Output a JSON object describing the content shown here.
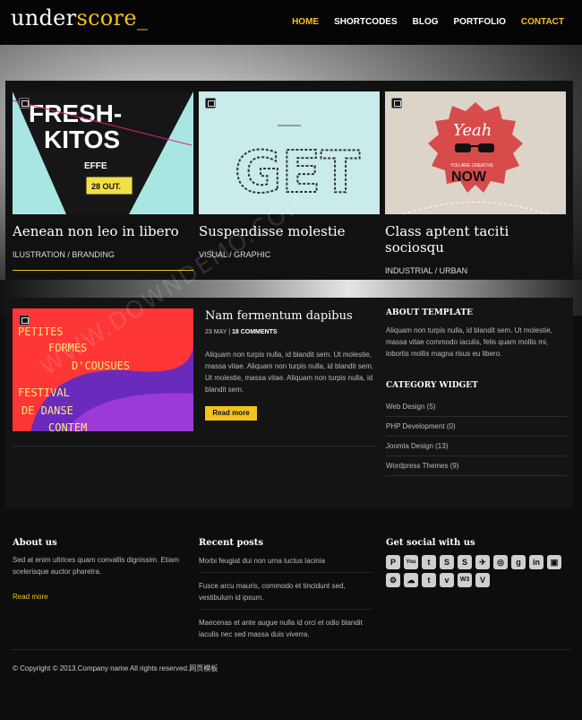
{
  "header": {
    "logo_main": "under",
    "logo_accent": "score_",
    "nav": [
      {
        "label": "HOME",
        "active": true
      },
      {
        "label": "SHORTCODES",
        "active": false
      },
      {
        "label": "BLOG",
        "active": false
      },
      {
        "label": "PORTFOLIO",
        "active": false
      },
      {
        "label": "CONTACT",
        "active": true
      }
    ]
  },
  "portfolio": [
    {
      "title": "Aenean non leo in libero",
      "category": "ILUSTRATION / BRANDING",
      "image_text": [
        "FRESH-",
        "KITOS",
        "EFFE",
        "28 OUT."
      ]
    },
    {
      "title": "Suspendisse molestie",
      "category": "VISUAL / GRAPHIC",
      "image_text": [
        "GET"
      ]
    },
    {
      "title": "Class aptent taciti sociosqu",
      "category": "INDUSTRIAL / URBAN",
      "image_text": [
        "Yeah",
        "YOU ARE CREATIVE",
        "NOW"
      ]
    }
  ],
  "post": {
    "title": "Nam fermentum dapibus",
    "date": "23 MAY",
    "comments": "18 COMMENTS",
    "body": "Aliquam non turpis nulla, id blandit sem. Ut molestie, massa vitae. Aliquam non turpis nulla, id blandit sem. Ut molestie, massa vitae. Aliquam non turpis nulla, id blandit sem.",
    "button": "Read more",
    "image_text": [
      "PETITES",
      "FORMES",
      "D'COUSUES",
      "FESTIVAL",
      "DE DANSE",
      "CONTEM"
    ]
  },
  "about": {
    "title": "ABOUT TEMPLATE",
    "text": "Aliquam non turpis nulla, id blandit sem. Ut molestie, massa vitae commodo iaculis, felis quam mollis mi, lobortis mollis magna risus eu libero."
  },
  "categories": {
    "title": "CATEGORY WIDGET",
    "items": [
      "Web Design (5)",
      "PHP Development (0)",
      "Joomla Design (13)",
      "Wordpress Themes (9)"
    ]
  },
  "footer": {
    "about": {
      "title": "About us",
      "text": "Sed at enim ultrices quam convallis dignissim. Etiam scelerisque auctor pharetra.",
      "link": "Read more"
    },
    "recent": {
      "title": "Recent posts",
      "items": [
        "Morbi feugiat dui non urna luctus lacinia",
        "Fusce arcu mauris, commodo et tincidunt sed, vestibulum id ipsum.",
        "Maecenas et ante augue nulla id orci et odio blandit iaculis nec sed massa duis viverra."
      ]
    },
    "social": {
      "title": "Get social with us",
      "icons": [
        "P",
        "You",
        "t",
        "S",
        "S",
        "✈",
        "◎",
        "g",
        "in",
        "▣",
        "⚙",
        "☁",
        "t",
        "v",
        "W3",
        "V"
      ]
    },
    "copyright": "© Copyright © 2013.Company name All rights reserved.网页模板"
  },
  "watermark": "WWW.DOWNDEMO.COM",
  "colors": {
    "accent": "#f2c21d",
    "bg": "#0e0e0e"
  }
}
